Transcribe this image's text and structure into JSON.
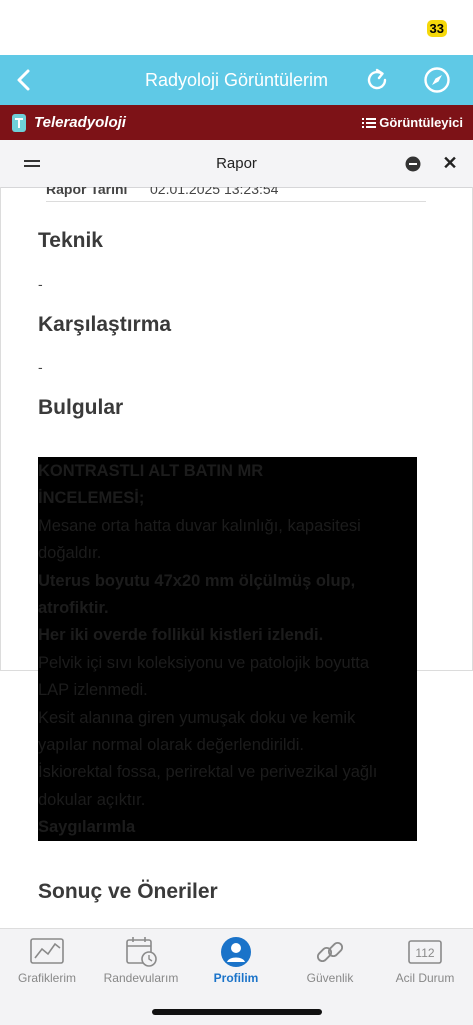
{
  "status": {
    "battery": "33"
  },
  "header": {
    "title": "Radyoloji Görüntülerim"
  },
  "brand": {
    "logo_text": "Teleradyoloji",
    "viewer_label": "Görüntüleyici"
  },
  "report_bar": {
    "title": "Rapor"
  },
  "report": {
    "date_label": "Rapor Tarihi",
    "date_value": "02.01.2025 13:23:54",
    "sections": [
      {
        "title": "Teknik",
        "value": "-"
      },
      {
        "title": "Karşılaştırma",
        "value": "-"
      },
      {
        "title": "Bulgular"
      },
      {
        "title": "Sonuç ve Öneriler"
      }
    ],
    "findings_lines": [
      "KONTRASTLI ALT BATIN MR",
      "İNCELEMESİ;",
      "Mesane orta hatta duvar kalınlığı, kapasitesi",
      "doğaldır.",
      "Uterus boyutu 47x20 mm ölçülmüş olup,",
      "atrofiktir.",
      "Her iki overde follikül kistleri izlendi.",
      "Pelvik içi sıvı koleksiyonu ve patolojik boyutta",
      "LAP izlenmedi.",
      "Kesit alanına giren yumuşak doku ve kemik",
      "yapılar normal olarak değerlendirildi.",
      "İskiorektal fossa, perirektal ve perivezikal yağlı",
      "dokular açıktır.",
      "Saygılarımla"
    ]
  },
  "tabs": [
    {
      "label": "Grafiklerim",
      "icon": "chart-icon"
    },
    {
      "label": "Randevularım",
      "icon": "calendar-icon"
    },
    {
      "label": "Profilim",
      "icon": "profile-icon"
    },
    {
      "label": "Güvenlik",
      "icon": "link-icon"
    },
    {
      "label": "Acil Durum",
      "icon": "emergency-112-icon",
      "icon_text": "112"
    }
  ],
  "colors": {
    "header": "#5fc9e6",
    "brand": "#7d1217",
    "active_tab": "#1a73c9"
  }
}
